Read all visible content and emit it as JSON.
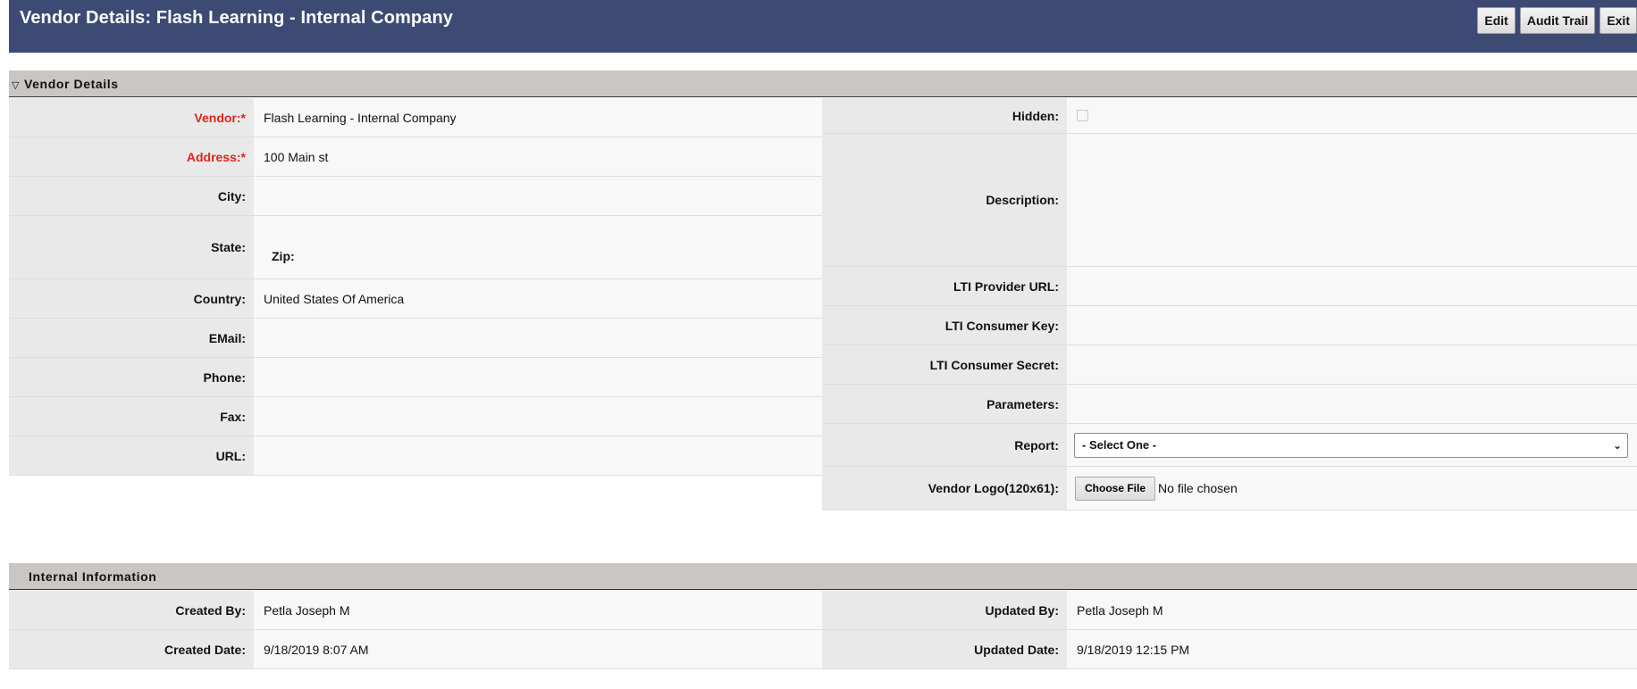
{
  "header": {
    "title": "Vendor Details: Flash Learning - Internal Company",
    "buttons": {
      "edit": "Edit",
      "audit_trail": "Audit Trail",
      "exit": "Exit"
    }
  },
  "vendor_section": {
    "title": "Vendor Details",
    "left": {
      "vendor_label": "Vendor:*",
      "vendor_value": "Flash Learning - Internal Company",
      "address_label": "Address:*",
      "address_value": "100 Main st",
      "city_label": "City:",
      "city_value": "",
      "state_label": "State:",
      "state_value": "",
      "zip_label": "Zip:",
      "zip_value": "",
      "country_label": "Country:",
      "country_value": "United States Of America",
      "email_label": "EMail:",
      "email_value": "",
      "phone_label": "Phone:",
      "phone_value": "",
      "fax_label": "Fax:",
      "fax_value": "",
      "url_label": "URL:",
      "url_value": ""
    },
    "right": {
      "hidden_label": "Hidden:",
      "description_label": "Description:",
      "description_value": "",
      "lti_url_label": "LTI Provider URL:",
      "lti_url_value": "",
      "lti_key_label": "LTI Consumer Key:",
      "lti_key_value": "",
      "lti_secret_label": "LTI Consumer Secret:",
      "lti_secret_value": "",
      "parameters_label": "Parameters:",
      "parameters_value": "",
      "report_label": "Report:",
      "report_selected": "- Select One -",
      "logo_label": "Vendor Logo(120x61):",
      "logo_button": "Choose File",
      "logo_status": "No file chosen"
    }
  },
  "internal_section": {
    "title": "Internal Information",
    "created_by_label": "Created By:",
    "created_by_value": "Petla Joseph M",
    "created_date_label": "Created Date:",
    "created_date_value": "9/18/2019 8:07 AM",
    "updated_by_label": "Updated By:",
    "updated_by_value": "Petla Joseph M",
    "updated_date_label": "Updated Date:",
    "updated_date_value": "9/18/2019 12:15 PM"
  }
}
